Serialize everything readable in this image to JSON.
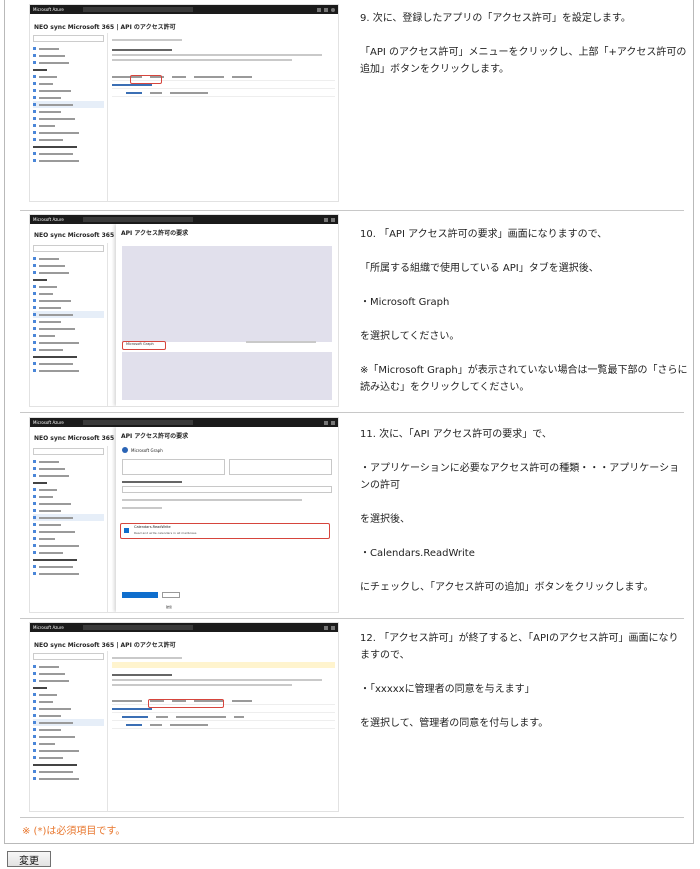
{
  "steps": [
    {
      "lines": [
        "9. 次に、登録したアプリの「アクセス許可」を設定します。",
        "",
        "「API のアクセス許可」メニューをクリックし、上部「+アクセス許可の追加」ボタンをクリックします。"
      ],
      "screenshot": {
        "brand": "Microsoft Azure",
        "title": "NEO sync Microsoft 365 | API のアクセス許可"
      }
    },
    {
      "lines": [
        "10. 「API アクセス許可の要求」画面になりますので、",
        "",
        "「所属する組織で使用している API」タブを選択後、",
        "",
        "・Microsoft Graph",
        "",
        "を選択してください。",
        "",
        "※「Microsoft Graph」が表示されていない場合は一覧最下部の「さらに読み込む」をクリックしてください。"
      ],
      "screenshot": {
        "brand": "Microsoft Azure",
        "title": "NEO sync Microsoft 365 | A",
        "panel_title": "API アクセス許可の要求",
        "tile_label": "Microsoft Graph"
      }
    },
    {
      "lines": [
        "11. 次に、「API アクセス許可の要求」で、",
        "",
        "・アプリケーションに必要なアクセス許可の種類・・・アプリケーションの許可",
        "",
        "を選択後、",
        "",
        "・Calendars.ReadWrite",
        "",
        "にチェックし、「アクセス許可の追加」ボタンをクリックします。"
      ],
      "screenshot": {
        "brand": "Microsoft Azure",
        "title": "NEO sync Microsoft 365",
        "panel_title": "API アクセス許可の要求",
        "api_name": "Microsoft Graph",
        "perm_name": "Calendars.ReadWrite",
        "perm_desc": "Read and write calendars in all mailboxes",
        "add_label": "アクセス許可の追加",
        "discard_label": "破棄"
      }
    },
    {
      "lines": [
        "12. 「アクセス許可」が終了すると、「APIのアクセス許可」画面になりますので、",
        "",
        "・「xxxxxに管理者の同意を与えます」",
        "",
        "を選択して、管理者の同意を付与します。"
      ],
      "screenshot": {
        "brand": "Microsoft Azure",
        "title": "NEO sync Microsoft 365 | API のアクセス許可"
      }
    }
  ],
  "footnote": "※ (*)は必須項目です。",
  "change_button": "変更"
}
